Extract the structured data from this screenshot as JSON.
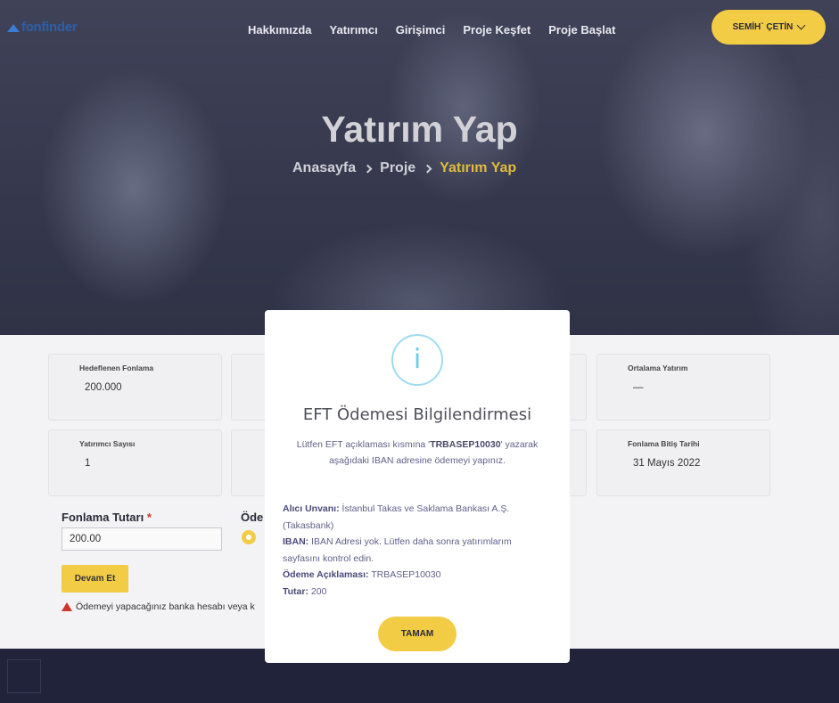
{
  "brand": {
    "logo_text": "fonfinder"
  },
  "nav": {
    "items": [
      "Hakkımızda",
      "Yatırımcı",
      "Girişimci",
      "Proje Keşfet",
      "Proje Başlat"
    ]
  },
  "user": {
    "name": "SEMİH` ÇETİN"
  },
  "hero": {
    "title": "Yatırım Yap",
    "breadcrumb": [
      "Anasayfa",
      "Proje",
      "Yatırım Yap"
    ]
  },
  "stats": {
    "target": {
      "label": "Hedeflenen Fonlama",
      "value": "200.000"
    },
    "average": {
      "label": "Ortalama Yatırım",
      "value": "—"
    },
    "investor_count": {
      "label": "Yatırımcı Sayısı",
      "value": "1"
    },
    "end_date": {
      "label": "Fonlama Bitiş Tarihi",
      "value": "31 Mayıs 2022"
    }
  },
  "form": {
    "amount_label": "Fonlama Tutarı",
    "required_mark": "*",
    "amount_value": "200.00",
    "payment_label": "Öde",
    "continue_label": "Devam Et",
    "warning_text": "Ödemeyi yapacağınız banka hesabı veya k"
  },
  "modal": {
    "icon": "info-icon",
    "title": "EFT Ödemesi Bilgilendirmesi",
    "desc_before": "Lütfen EFT açıklaması kısmına '",
    "desc_code": "TRBASEP10030",
    "desc_after": "' yazarak aşağıdaki IBAN adresine ödemeyi yapınız.",
    "receiver_label": "Alıcı Unvanı:",
    "receiver_value": "İstanbul Takas ve Saklama Bankası A.Ş. (Takasbank)",
    "iban_label": "IBAN:",
    "iban_value": "IBAN Adresi yok. Lütfen daha sonra yatırımlarım sayfasını kontrol edin.",
    "desc_label": "Ödeme Açıklaması:",
    "desc_value": "TRBASEP10030",
    "amount_label": "Tutar:",
    "amount_value": "200",
    "ok_label": "TAMAM"
  },
  "colors": {
    "accent": "#f3cc45",
    "footer": "#20233a",
    "info": "#6ccbeb"
  }
}
